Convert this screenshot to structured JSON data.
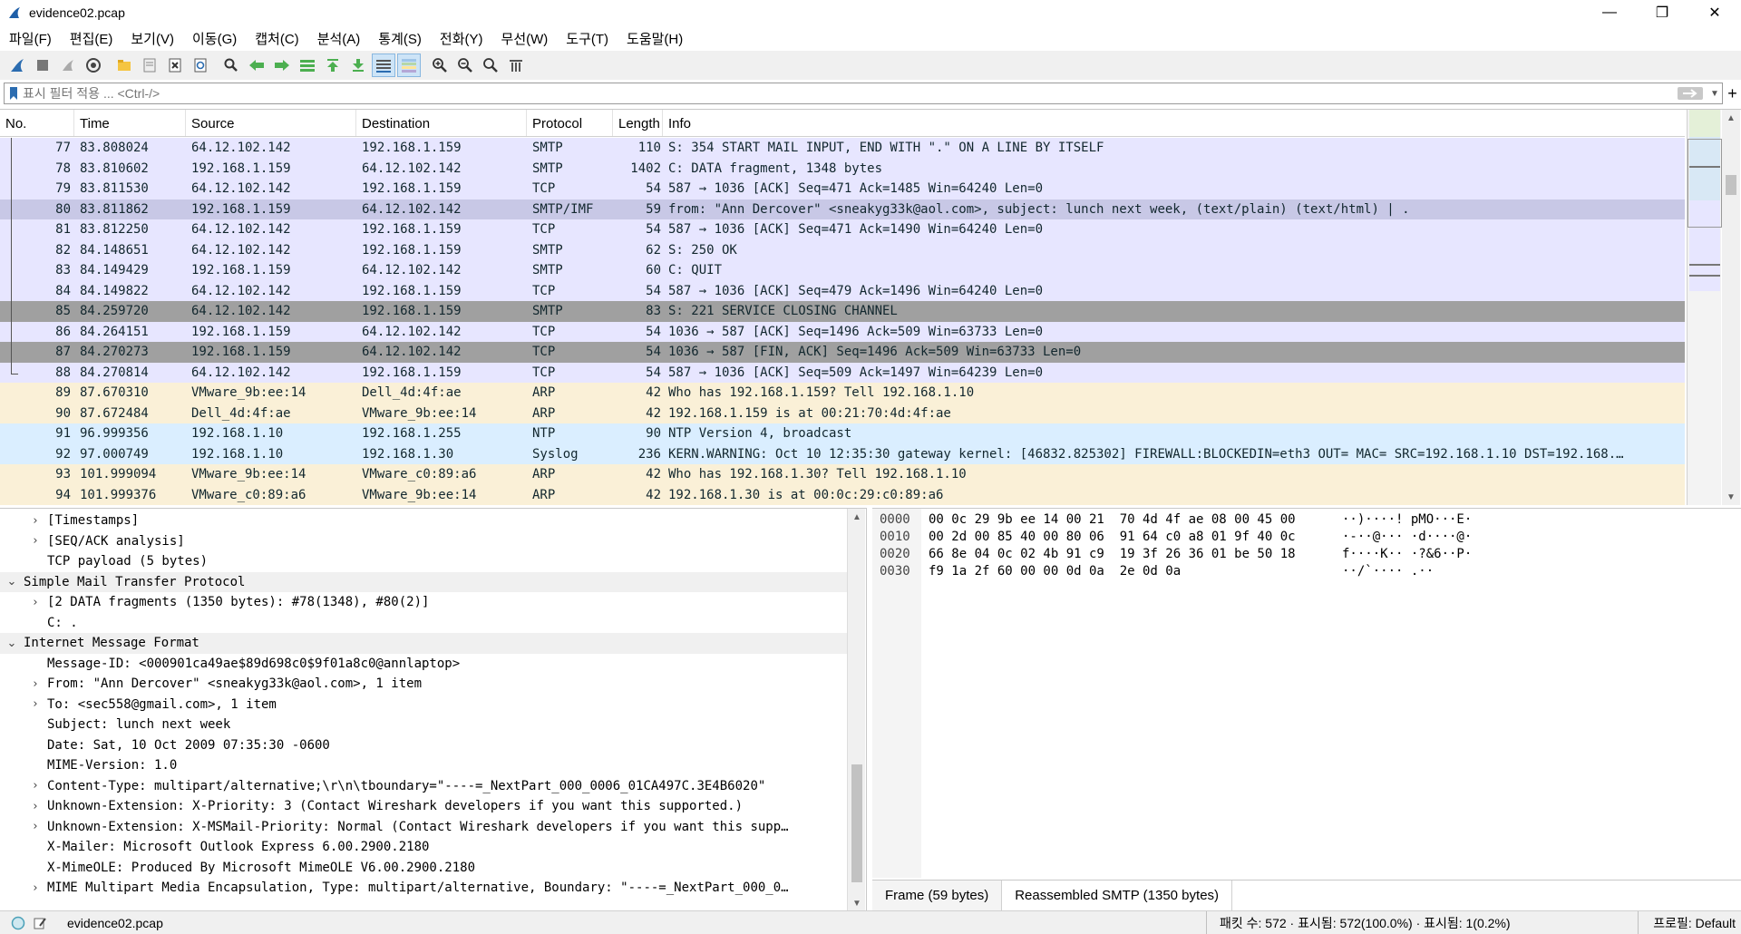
{
  "window": {
    "title": "evidence02.pcap",
    "minimize": "—",
    "maximize": "❐",
    "close": "✕"
  },
  "menu": [
    "파일(F)",
    "편집(E)",
    "보기(V)",
    "이동(G)",
    "캡처(C)",
    "분석(A)",
    "통계(S)",
    "전화(Y)",
    "무선(W)",
    "도구(T)",
    "도움말(H)"
  ],
  "filter": {
    "placeholder": "표시 필터 적용 ... <Ctrl-/>",
    "add": "+"
  },
  "packet_list": {
    "columns": [
      "No.",
      "Time",
      "Source",
      "Destination",
      "Protocol",
      "Length",
      "Info"
    ],
    "rows": [
      {
        "no": "77",
        "time": "83.808024",
        "src": "64.12.102.142",
        "dst": "192.168.1.159",
        "proto": "SMTP",
        "len": "110",
        "info": "S: 354 START MAIL INPUT, END WITH \".\" ON A LINE BY ITSELF",
        "bg": "#e7e6ff",
        "fg": "#12272e"
      },
      {
        "no": "78",
        "time": "83.810602",
        "src": "192.168.1.159",
        "dst": "64.12.102.142",
        "proto": "SMTP",
        "len": "1402",
        "info": "C: DATA fragment, 1348 bytes",
        "bg": "#e7e6ff",
        "fg": "#12272e"
      },
      {
        "no": "79",
        "time": "83.811530",
        "src": "64.12.102.142",
        "dst": "192.168.1.159",
        "proto": "TCP",
        "len": "54",
        "info": "587 → 1036 [ACK] Seq=471 Ack=1485 Win=64240 Len=0",
        "bg": "#e7e6ff",
        "fg": "#12272e"
      },
      {
        "no": "80",
        "time": "83.811862",
        "src": "192.168.1.159",
        "dst": "64.12.102.142",
        "proto": "SMTP/IMF",
        "len": "59",
        "info": "from: \"Ann Dercover\" <sneakyg33k@aol.com>, subject: lunch next week,  (text/plain) (text/html) | .",
        "bg": "#c8c8e6",
        "fg": "#12272e"
      },
      {
        "no": "81",
        "time": "83.812250",
        "src": "64.12.102.142",
        "dst": "192.168.1.159",
        "proto": "TCP",
        "len": "54",
        "info": "587 → 1036 [ACK] Seq=471 Ack=1490 Win=64240 Len=0",
        "bg": "#e7e6ff",
        "fg": "#12272e"
      },
      {
        "no": "82",
        "time": "84.148651",
        "src": "64.12.102.142",
        "dst": "192.168.1.159",
        "proto": "SMTP",
        "len": "62",
        "info": "S: 250 OK",
        "bg": "#e7e6ff",
        "fg": "#12272e"
      },
      {
        "no": "83",
        "time": "84.149429",
        "src": "192.168.1.159",
        "dst": "64.12.102.142",
        "proto": "SMTP",
        "len": "60",
        "info": "C: QUIT",
        "bg": "#e7e6ff",
        "fg": "#12272e"
      },
      {
        "no": "84",
        "time": "84.149822",
        "src": "64.12.102.142",
        "dst": "192.168.1.159",
        "proto": "TCP",
        "len": "54",
        "info": "587 → 1036 [ACK] Seq=479 Ack=1496 Win=64240 Len=0",
        "bg": "#e7e6ff",
        "fg": "#12272e"
      },
      {
        "no": "85",
        "time": "84.259720",
        "src": "64.12.102.142",
        "dst": "192.168.1.159",
        "proto": "SMTP",
        "len": "83",
        "info": "S: 221 SERVICE CLOSING CHANNEL",
        "bg": "#a0a0a0",
        "fg": "#12272e"
      },
      {
        "no": "86",
        "time": "84.264151",
        "src": "192.168.1.159",
        "dst": "64.12.102.142",
        "proto": "TCP",
        "len": "54",
        "info": "1036 → 587 [ACK] Seq=1496 Ack=509 Win=63733 Len=0",
        "bg": "#e7e6ff",
        "fg": "#12272e"
      },
      {
        "no": "87",
        "time": "84.270273",
        "src": "192.168.1.159",
        "dst": "64.12.102.142",
        "proto": "TCP",
        "len": "54",
        "info": "1036 → 587 [FIN, ACK] Seq=1496 Ack=509 Win=63733 Len=0",
        "bg": "#a0a0a0",
        "fg": "#12272e"
      },
      {
        "no": "88",
        "time": "84.270814",
        "src": "64.12.102.142",
        "dst": "192.168.1.159",
        "proto": "TCP",
        "len": "54",
        "info": "587 → 1036 [ACK] Seq=509 Ack=1497 Win=64239 Len=0",
        "bg": "#e7e6ff",
        "fg": "#12272e"
      },
      {
        "no": "89",
        "time": "87.670310",
        "src": "VMware_9b:ee:14",
        "dst": "Dell_4d:4f:ae",
        "proto": "ARP",
        "len": "42",
        "info": "Who has 192.168.1.159? Tell 192.168.1.10",
        "bg": "#faf0d7",
        "fg": "#12272e"
      },
      {
        "no": "90",
        "time": "87.672484",
        "src": "Dell_4d:4f:ae",
        "dst": "VMware_9b:ee:14",
        "proto": "ARP",
        "len": "42",
        "info": "192.168.1.159 is at 00:21:70:4d:4f:ae",
        "bg": "#faf0d7",
        "fg": "#12272e"
      },
      {
        "no": "91",
        "time": "96.999356",
        "src": "192.168.1.10",
        "dst": "192.168.1.255",
        "proto": "NTP",
        "len": "90",
        "info": "NTP Version 4, broadcast",
        "bg": "#daeeff",
        "fg": "#12272e"
      },
      {
        "no": "92",
        "time": "97.000749",
        "src": "192.168.1.10",
        "dst": "192.168.1.30",
        "proto": "Syslog",
        "len": "236",
        "info": "KERN.WARNING: Oct 10 12:35:30 gateway kernel: [46832.825302] FIREWALL:BLOCKEDIN=eth3 OUT= MAC= SRC=192.168.1.10 DST=192.168.…",
        "bg": "#daeeff",
        "fg": "#12272e"
      },
      {
        "no": "93",
        "time": "101.999094",
        "src": "VMware_9b:ee:14",
        "dst": "VMware_c0:89:a6",
        "proto": "ARP",
        "len": "42",
        "info": "Who has 192.168.1.30? Tell 192.168.1.10",
        "bg": "#faf0d7",
        "fg": "#12272e"
      },
      {
        "no": "94",
        "time": "101.999376",
        "src": "VMware_c0:89:a6",
        "dst": "VMware_9b:ee:14",
        "proto": "ARP",
        "len": "42",
        "info": "192.168.1.30 is at 00:0c:29:c0:89:a6",
        "bg": "#faf0d7",
        "fg": "#12272e"
      }
    ]
  },
  "details": [
    {
      "text": "[Timestamps]",
      "indent": 1,
      "exp": "›",
      "section": false
    },
    {
      "text": "[SEQ/ACK analysis]",
      "indent": 1,
      "exp": "›",
      "section": false
    },
    {
      "text": "TCP payload (5 bytes)",
      "indent": 1,
      "exp": "",
      "section": false
    },
    {
      "text": "Simple Mail Transfer Protocol",
      "indent": 0,
      "exp": "⌄",
      "section": true
    },
    {
      "text": "[2 DATA fragments (1350 bytes): #78(1348), #80(2)]",
      "indent": 1,
      "exp": "›",
      "section": false
    },
    {
      "text": "C: .",
      "indent": 1,
      "exp": "",
      "section": false
    },
    {
      "text": "Internet Message Format",
      "indent": 0,
      "exp": "⌄",
      "section": true
    },
    {
      "text": "Message-ID: <000901ca49ae$89d698c0$9f01a8c0@annlaptop>",
      "indent": 1,
      "exp": "",
      "section": false
    },
    {
      "text": "From: \"Ann Dercover\" <sneakyg33k@aol.com>, 1 item",
      "indent": 1,
      "exp": "›",
      "section": false
    },
    {
      "text": "To: <sec558@gmail.com>, 1 item",
      "indent": 1,
      "exp": "›",
      "section": false
    },
    {
      "text": "Subject: lunch next week",
      "indent": 1,
      "exp": "",
      "section": false
    },
    {
      "text": "Date: Sat, 10 Oct 2009 07:35:30 -0600",
      "indent": 1,
      "exp": "",
      "section": false
    },
    {
      "text": "MIME-Version: 1.0",
      "indent": 1,
      "exp": "",
      "section": false
    },
    {
      "text": "Content-Type: multipart/alternative;\\r\\n\\tboundary=\"----=_NextPart_000_0006_01CA497C.3E4B6020\"",
      "indent": 1,
      "exp": "›",
      "section": false
    },
    {
      "text": "Unknown-Extension: X-Priority: 3 (Contact Wireshark developers if you want this supported.)",
      "indent": 1,
      "exp": "›",
      "section": false
    },
    {
      "text": "Unknown-Extension: X-MSMail-Priority: Normal (Contact Wireshark developers if you want this supp…",
      "indent": 1,
      "exp": "›",
      "section": false
    },
    {
      "text": "X-Mailer: Microsoft Outlook Express 6.00.2900.2180",
      "indent": 1,
      "exp": "",
      "section": false
    },
    {
      "text": "X-MimeOLE: Produced By Microsoft MimeOLE V6.00.2900.2180",
      "indent": 1,
      "exp": "",
      "section": false
    },
    {
      "text": "MIME Multipart Media Encapsulation, Type: multipart/alternative, Boundary: \"----=_NextPart_000_0…",
      "indent": 1,
      "exp": "›",
      "section": false
    }
  ],
  "hex": {
    "offsets": [
      "0000",
      "0010",
      "0020",
      "0030"
    ],
    "bytes": [
      "00 0c 29 9b ee 14 00 21  70 4d 4f ae 08 00 45 00",
      "00 2d 00 85 40 00 80 06  91 64 c0 a8 01 9f 40 0c",
      "66 8e 04 0c 02 4b 91 c9  19 3f 26 36 01 be 50 18",
      "f9 1a 2f 60 00 00 0d 0a  2e 0d 0a"
    ],
    "ascii": [
      "··)····! pMO···E·",
      "·-··@··· ·d····@·",
      "f····K·· ·?&6··P·",
      "··/`···· .··"
    ],
    "tabs": [
      "Frame (59 bytes)",
      "Reassembled SMTP (1350 bytes)"
    ]
  },
  "status": {
    "file": "evidence02.pcap",
    "packets": "패킷 수: 572 · 표시됨: 572(100.0%) · 표시됨: 1(0.2%)",
    "profile": "프로필: Default"
  }
}
